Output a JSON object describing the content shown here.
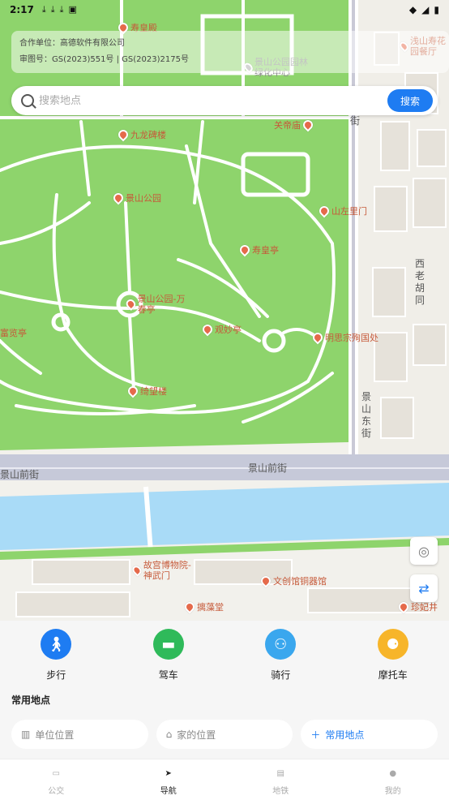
{
  "status_bar": {
    "time": "2:17",
    "notification_icons": [
      "download-icon",
      "download-icon",
      "download-icon",
      "app-icon"
    ],
    "system_icons": [
      "wifi-icon",
      "signal-icon",
      "battery-icon"
    ]
  },
  "map": {
    "copyright": {
      "line1": "合作单位：高德软件有限公司",
      "line2": "审图号：GS(2023)551号 | GS(2023)2175号"
    },
    "pois": [
      {
        "name": "寿皇殿"
      },
      {
        "name": "景山公园园林绿化中心"
      },
      {
        "name": "浅山寿花园餐厅"
      },
      {
        "name": "关帝庙"
      },
      {
        "name": "九龙碑楼"
      },
      {
        "name": "景山公园"
      },
      {
        "name": "山左里门"
      },
      {
        "name": "寿皇亭"
      },
      {
        "name": "景山公园-万春亭"
      },
      {
        "name": "富览亭"
      },
      {
        "name": "观妙亭"
      },
      {
        "name": "明思宗殉国处"
      },
      {
        "name": "绮望楼"
      },
      {
        "name": "故宫博物院-神武门"
      },
      {
        "name": "文创馆铜器馆"
      },
      {
        "name": "摛藻堂"
      },
      {
        "name": "珍妃井"
      }
    ],
    "streets": {
      "jingshan_qianjie_left": "景山前街",
      "jingshan_qianjie": "景山前街",
      "jingshan_dongjie": "景山东街",
      "xilao_hutong": "西老胡同",
      "jie": "街"
    }
  },
  "search": {
    "placeholder": "搜索地点",
    "button": "搜索"
  },
  "modes": [
    {
      "label": "步行",
      "icon": "walk-icon",
      "color": "#1e7cf2"
    },
    {
      "label": "驾车",
      "icon": "car-icon",
      "color": "#2fba5a"
    },
    {
      "label": "骑行",
      "icon": "bike-icon",
      "color": "#3aa7ee"
    },
    {
      "label": "摩托车",
      "icon": "motorcycle-icon",
      "color": "#f7b52a"
    }
  ],
  "common_places": {
    "title": "常用地点",
    "work": "单位位置",
    "home": "家的位置",
    "add": "常用地点"
  },
  "tabs": [
    {
      "label": "公交",
      "icon": "bus-icon",
      "active": false
    },
    {
      "label": "导航",
      "icon": "navigation-icon",
      "active": true
    },
    {
      "label": "地铁",
      "icon": "subway-icon",
      "active": false
    },
    {
      "label": "我的",
      "icon": "user-icon",
      "active": false
    }
  ]
}
